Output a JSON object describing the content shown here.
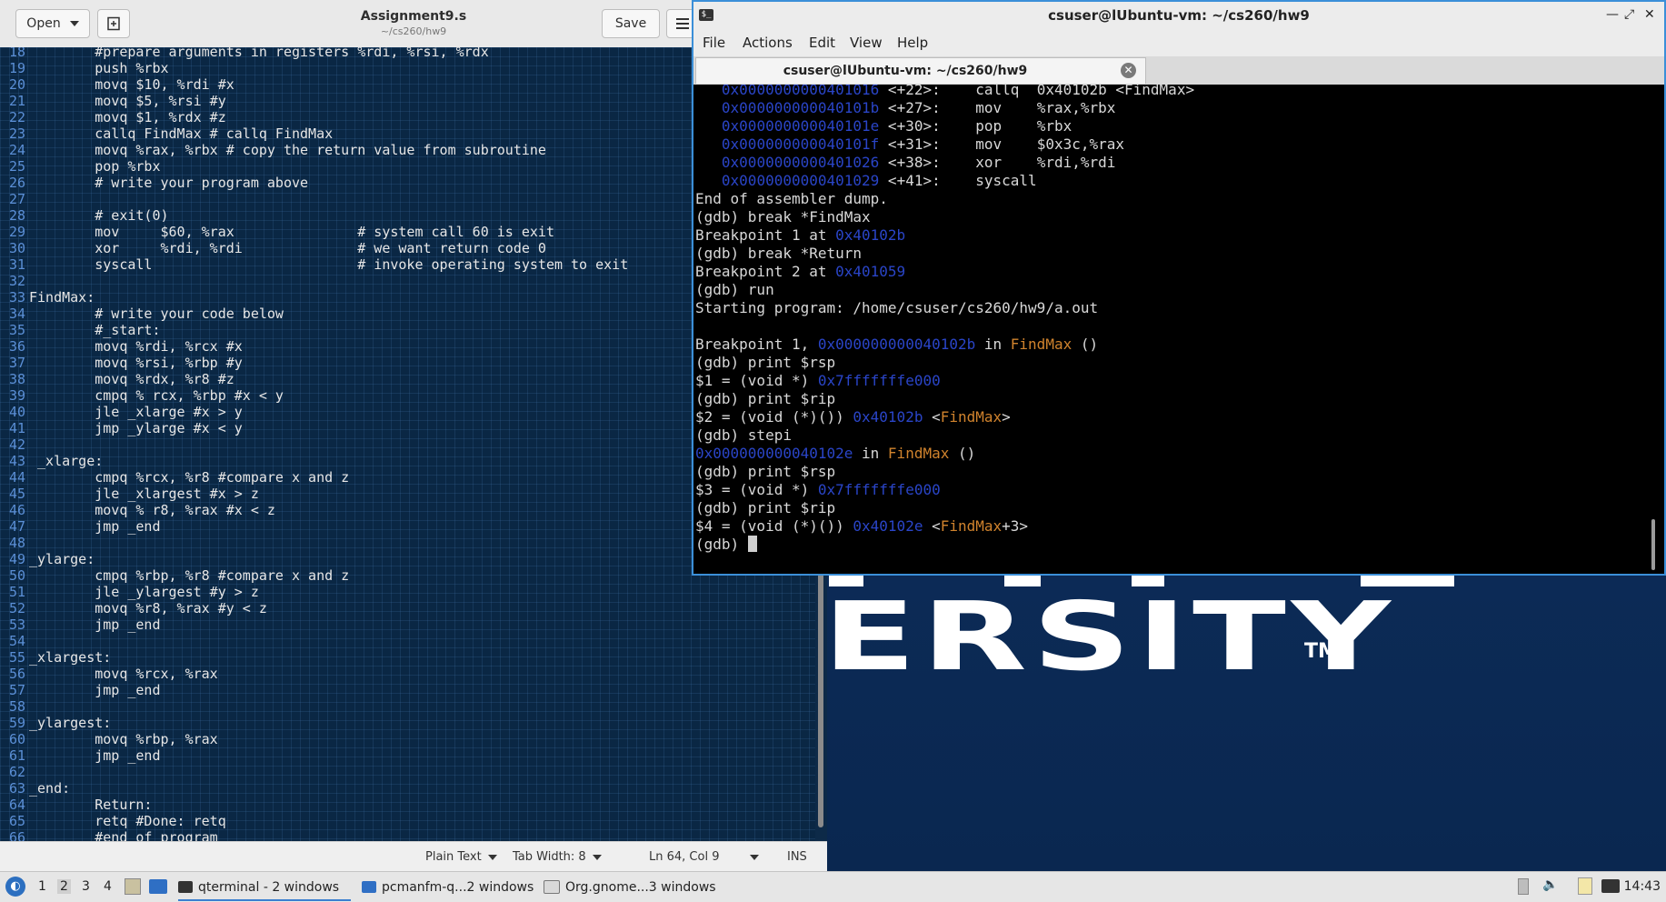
{
  "editor": {
    "title": "Assignment9.s",
    "subtitle": "~/cs260/hw9",
    "open_label": "Open",
    "save_label": "Save",
    "lines": [
      {
        "n": "18",
        "t": "        #prepare arguments in registers %rdi, %rsi, %rdx"
      },
      {
        "n": "19",
        "t": "        push %rbx"
      },
      {
        "n": "20",
        "t": "        movq $10, %rdi #x"
      },
      {
        "n": "21",
        "t": "        movq $5, %rsi #y"
      },
      {
        "n": "22",
        "t": "        movq $1, %rdx #z"
      },
      {
        "n": "23",
        "t": "        callq FindMax # callq FindMax"
      },
      {
        "n": "24",
        "t": "        movq %rax, %rbx # copy the return value from subroutine"
      },
      {
        "n": "25",
        "t": "        pop %rbx"
      },
      {
        "n": "26",
        "t": "        # write your program above"
      },
      {
        "n": "27",
        "t": ""
      },
      {
        "n": "28",
        "t": "        # exit(0)"
      },
      {
        "n": "29",
        "t": "        mov     $60, %rax               # system call 60 is exit"
      },
      {
        "n": "30",
        "t": "        xor     %rdi, %rdi              # we want return code 0"
      },
      {
        "n": "31",
        "t": "        syscall                         # invoke operating system to exit"
      },
      {
        "n": "32",
        "t": ""
      },
      {
        "n": "33",
        "t": "FindMax:"
      },
      {
        "n": "34",
        "t": "        # write your code below"
      },
      {
        "n": "35",
        "t": "        #_start:"
      },
      {
        "n": "36",
        "t": "        movq %rdi, %rcx #x"
      },
      {
        "n": "37",
        "t": "        movq %rsi, %rbp #y"
      },
      {
        "n": "38",
        "t": "        movq %rdx, %r8 #z"
      },
      {
        "n": "39",
        "t": "        cmpq % rcx, %rbp #x < y"
      },
      {
        "n": "40",
        "t": "        jle _xlarge #x > y"
      },
      {
        "n": "41",
        "t": "        jmp _ylarge #x < y"
      },
      {
        "n": "42",
        "t": ""
      },
      {
        "n": "43",
        "t": " _xlarge:"
      },
      {
        "n": "44",
        "t": "        cmpq %rcx, %r8 #compare x and z"
      },
      {
        "n": "45",
        "t": "        jle _xlargest #x > z"
      },
      {
        "n": "46",
        "t": "        movq % r8, %rax #x < z"
      },
      {
        "n": "47",
        "t": "        jmp _end"
      },
      {
        "n": "48",
        "t": ""
      },
      {
        "n": "49",
        "t": "_ylarge:"
      },
      {
        "n": "50",
        "t": "        cmpq %rbp, %r8 #compare x and z"
      },
      {
        "n": "51",
        "t": "        jle _ylargest #y > z"
      },
      {
        "n": "52",
        "t": "        movq %r8, %rax #y < z"
      },
      {
        "n": "53",
        "t": "        jmp _end"
      },
      {
        "n": "54",
        "t": ""
      },
      {
        "n": "55",
        "t": "_xlargest:"
      },
      {
        "n": "56",
        "t": "        movq %rcx, %rax"
      },
      {
        "n": "57",
        "t": "        jmp _end"
      },
      {
        "n": "58",
        "t": ""
      },
      {
        "n": "59",
        "t": "_ylargest:"
      },
      {
        "n": "60",
        "t": "        movq %rbp, %rax"
      },
      {
        "n": "61",
        "t": "        jmp _end"
      },
      {
        "n": "62",
        "t": ""
      },
      {
        "n": "63",
        "t": "_end:"
      },
      {
        "n": "64",
        "t": "        Return:"
      },
      {
        "n": "65",
        "t": "        retq #Done: retq"
      },
      {
        "n": "66",
        "t": "        #end of program"
      }
    ],
    "status": {
      "language": "Plain Text",
      "tab_width": "Tab Width: 8",
      "position": "Ln 64, Col 9",
      "mode": "INS"
    }
  },
  "terminal": {
    "title": "csuser@lUbuntu-vm: ~/cs260/hw9",
    "tab_label": "csuser@lUbuntu-vm: ~/cs260/hw9",
    "menu": [
      "File",
      "Actions",
      "Edit",
      "View",
      "Help"
    ],
    "lines": [
      [
        {
          "t": "   "
        },
        {
          "t": "0x0000000000401016",
          "c": "addr"
        },
        {
          "t": " <+22>:    callq  0x40102b <FindMax>"
        }
      ],
      [
        {
          "t": "   "
        },
        {
          "t": "0x000000000040101b",
          "c": "addr"
        },
        {
          "t": " <+27>:    mov    %rax,%rbx"
        }
      ],
      [
        {
          "t": "   "
        },
        {
          "t": "0x000000000040101e",
          "c": "addr"
        },
        {
          "t": " <+30>:    pop    %rbx"
        }
      ],
      [
        {
          "t": "   "
        },
        {
          "t": "0x000000000040101f",
          "c": "addr"
        },
        {
          "t": " <+31>:    mov    $0x3c,%rax"
        }
      ],
      [
        {
          "t": "   "
        },
        {
          "t": "0x0000000000401026",
          "c": "addr"
        },
        {
          "t": " <+38>:    xor    %rdi,%rdi"
        }
      ],
      [
        {
          "t": "   "
        },
        {
          "t": "0x0000000000401029",
          "c": "addr"
        },
        {
          "t": " <+41>:    syscall"
        }
      ],
      [
        {
          "t": "End of assembler dump."
        }
      ],
      [
        {
          "t": "(gdb) break *FindMax"
        }
      ],
      [
        {
          "t": "Breakpoint 1 at "
        },
        {
          "t": "0x40102b",
          "c": "addr"
        }
      ],
      [
        {
          "t": "(gdb) break *Return"
        }
      ],
      [
        {
          "t": "Breakpoint 2 at "
        },
        {
          "t": "0x401059",
          "c": "addr"
        }
      ],
      [
        {
          "t": "(gdb) run"
        }
      ],
      [
        {
          "t": "Starting program: /home/csuser/cs260/hw9/a.out"
        }
      ],
      [
        {
          "t": ""
        }
      ],
      [
        {
          "t": "Breakpoint 1, "
        },
        {
          "t": "0x000000000040102b",
          "c": "addr"
        },
        {
          "t": " in "
        },
        {
          "t": "FindMax",
          "c": "func"
        },
        {
          "t": " ()"
        }
      ],
      [
        {
          "t": "(gdb) print $rsp"
        }
      ],
      [
        {
          "t": "$1 = (void *) "
        },
        {
          "t": "0x7fffffffe000",
          "c": "addr"
        }
      ],
      [
        {
          "t": "(gdb) print $rip"
        }
      ],
      [
        {
          "t": "$2 = (void (*)()) "
        },
        {
          "t": "0x40102b",
          "c": "addr"
        },
        {
          "t": " <"
        },
        {
          "t": "FindMax",
          "c": "func"
        },
        {
          "t": ">"
        }
      ],
      [
        {
          "t": "(gdb) stepi"
        }
      ],
      [
        {
          "t": "0x000000000040102e",
          "c": "addr"
        },
        {
          "t": " in "
        },
        {
          "t": "FindMax",
          "c": "func"
        },
        {
          "t": " ()"
        }
      ],
      [
        {
          "t": "(gdb) print $rsp"
        }
      ],
      [
        {
          "t": "$3 = (void *) "
        },
        {
          "t": "0x7fffffffe000",
          "c": "addr"
        }
      ],
      [
        {
          "t": "(gdb) print $rip"
        }
      ],
      [
        {
          "t": "$4 = (void (*)()) "
        },
        {
          "t": "0x40102e",
          "c": "addr"
        },
        {
          "t": " <"
        },
        {
          "t": "FindMax",
          "c": "func"
        },
        {
          "t": "+3>"
        }
      ],
      [
        {
          "t": "(gdb) "
        },
        {
          "cursor": true
        }
      ]
    ]
  },
  "wallpaper": {
    "logo_text": "ERSITY",
    "tm": "TM"
  },
  "taskbar": {
    "workspaces": [
      "1",
      "2",
      "3",
      "4"
    ],
    "tasks": [
      "qterminal - 2 windows",
      "pcmanfm-q...2 windows",
      "Org.gnome...3 windows"
    ],
    "clock": "14:43"
  },
  "colors": {
    "accent": "#3b8fd8",
    "code_bg": "#0a2744",
    "address": "#2a45c8",
    "function": "#d0832d"
  }
}
